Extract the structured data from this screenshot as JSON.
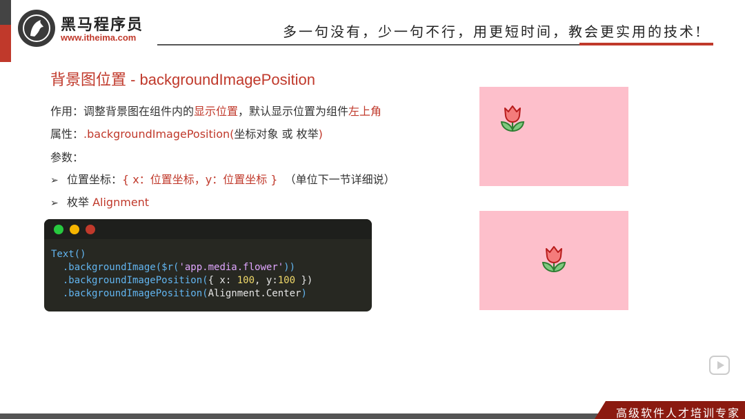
{
  "header": {
    "logo_name": "黑马程序员",
    "logo_url": "www.itheima.com",
    "slogan": "多一句没有，少一句不行，用更短时间，教会更实用的技术!"
  },
  "slide": {
    "title": "背景图位置 - backgroundImagePosition",
    "line1": {
      "a": "作用：调整背景图在组件内的",
      "b": "显示位置",
      "c": "，默认显示位置为组件",
      "d": "左上角"
    },
    "line2": {
      "a": "属性：",
      "b": ".backgroundImagePosition(",
      "c": "坐标对象 或 枚举",
      "d": ")"
    },
    "line3": "参数：",
    "line4": {
      "bullet": "➢",
      "a": "位置坐标：",
      "b": "{ x：位置坐标，y：位置坐标 }",
      "c": "（单位下一节详细说）"
    },
    "line5": {
      "bullet": "➢",
      "a": "枚举 ",
      "b": "Alignment"
    }
  },
  "code": {
    "line1": "Text()",
    "line2_a": "  .backgroundImage(",
    "line2_b": "$r",
    "line2_c": "(",
    "line2_d": "'app.media.flower'",
    "line2_e": "))",
    "line3_a": "  .backgroundImagePosition(",
    "line3_b": "{ x: ",
    "line3_c": "100",
    "line3_d": ", y:",
    "line3_e": "100",
    "line3_f": " })",
    "line4_a": "  .backgroundImagePosition(",
    "line4_b": "Alignment.Center",
    "line4_c": ")"
  },
  "footer": {
    "tagline": "高级软件人才培训专家"
  },
  "colors": {
    "accent": "#c0392b",
    "demo_bg": "#fdbfcb",
    "code_bg": "#272822"
  },
  "icons": [
    "horse-logo-icon",
    "tulip-icon",
    "play-icon"
  ]
}
